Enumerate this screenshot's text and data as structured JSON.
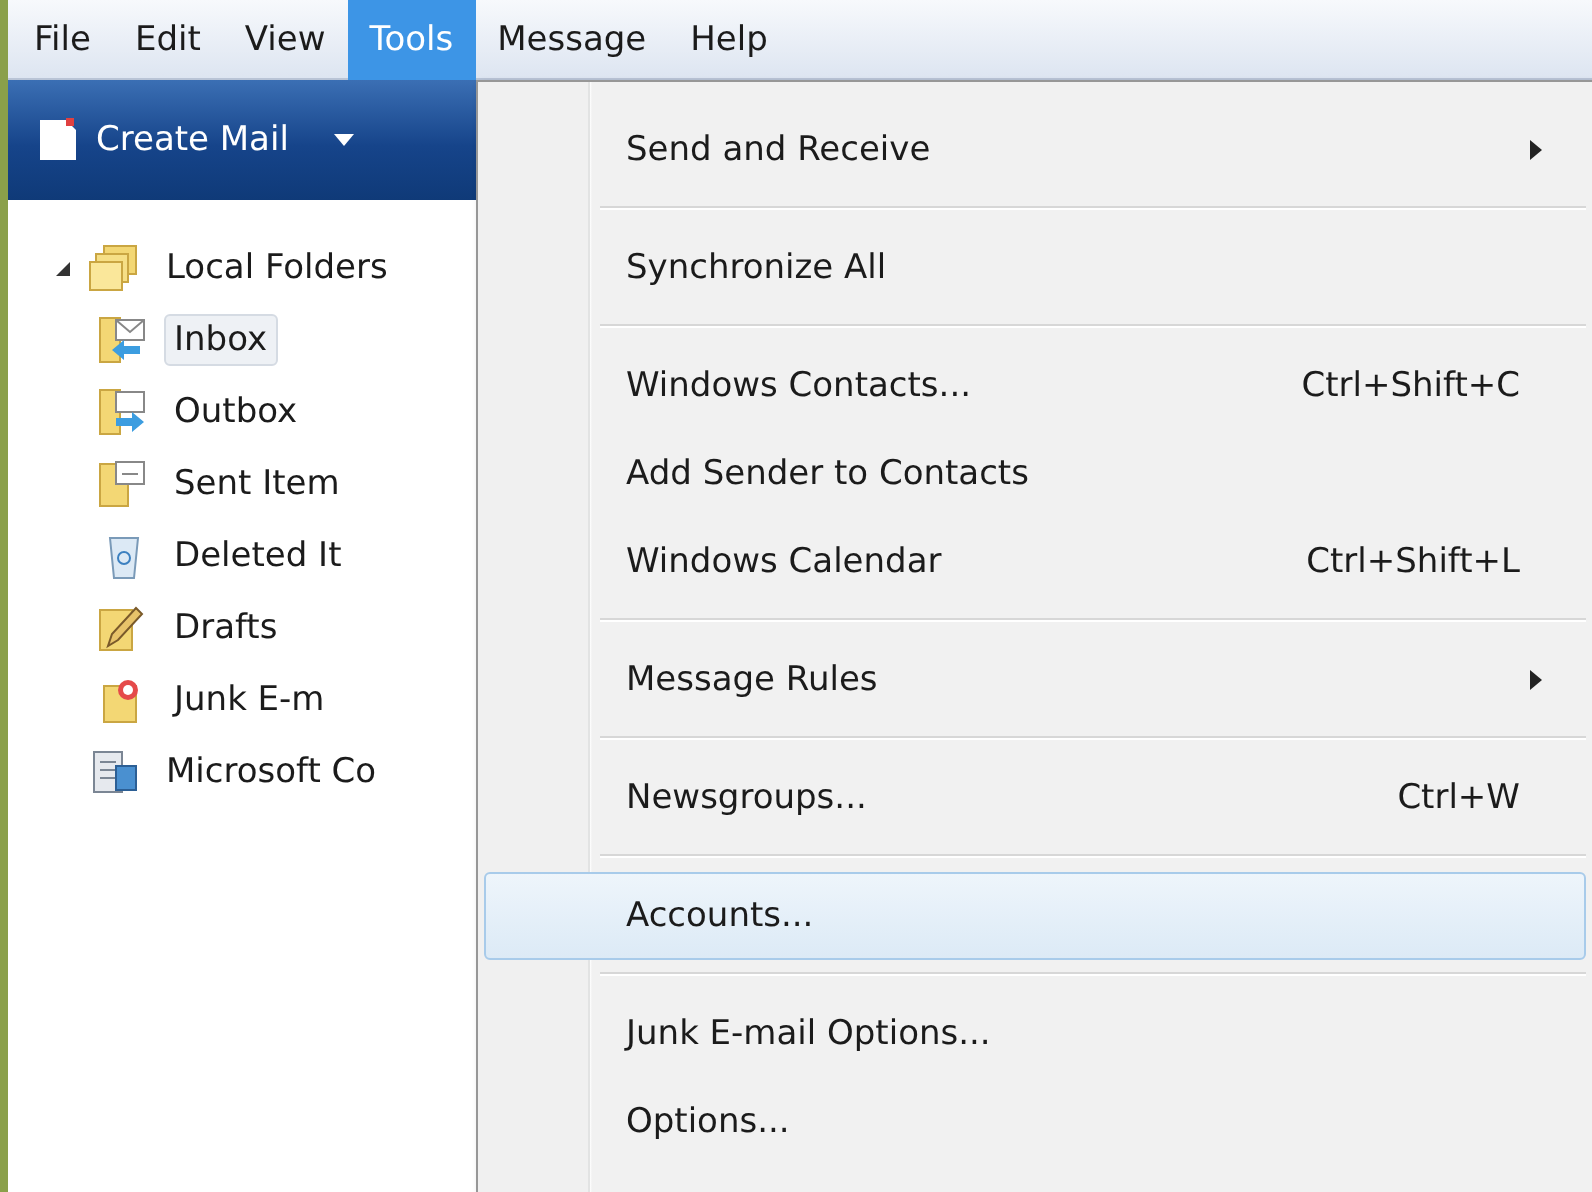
{
  "menubar": [
    {
      "label": "File",
      "selected": false
    },
    {
      "label": "Edit",
      "selected": false
    },
    {
      "label": "View",
      "selected": false
    },
    {
      "label": "Tools",
      "selected": true
    },
    {
      "label": "Message",
      "selected": false
    },
    {
      "label": "Help",
      "selected": false
    }
  ],
  "toolbar": {
    "create_mail": "Create Mail"
  },
  "folders": [
    {
      "label": "Local Folders",
      "expanded": true,
      "selected": false,
      "children": [
        {
          "label": "Inbox",
          "selected": true
        },
        {
          "label": "Outbox",
          "selected": false
        },
        {
          "label": "Sent Item",
          "selected": false
        },
        {
          "label": "Deleted It",
          "selected": false
        },
        {
          "label": "Drafts",
          "selected": false
        },
        {
          "label": "Junk E-m",
          "selected": false
        }
      ]
    },
    {
      "label": "Microsoft Co",
      "selected": false
    }
  ],
  "tools_menu": [
    {
      "kind": "item",
      "label": "Send and Receive",
      "submenu": true,
      "selected": false
    },
    {
      "kind": "separator"
    },
    {
      "kind": "item",
      "label": "Synchronize All",
      "selected": false
    },
    {
      "kind": "separator"
    },
    {
      "kind": "item",
      "label": "Windows Contacts...",
      "shortcut": "Ctrl+Shift+C",
      "selected": false
    },
    {
      "kind": "item",
      "label": "Add Sender to Contacts",
      "selected": false
    },
    {
      "kind": "item",
      "label": "Windows Calendar",
      "shortcut": "Ctrl+Shift+L",
      "selected": false
    },
    {
      "kind": "separator"
    },
    {
      "kind": "item",
      "label": "Message Rules",
      "submenu": true,
      "selected": false
    },
    {
      "kind": "separator"
    },
    {
      "kind": "item",
      "label": "Newsgroups...",
      "shortcut": "Ctrl+W",
      "selected": false
    },
    {
      "kind": "separator"
    },
    {
      "kind": "item",
      "label": "Accounts...",
      "selected": true
    },
    {
      "kind": "separator"
    },
    {
      "kind": "item",
      "label": "Junk E-mail Options...",
      "selected": false
    },
    {
      "kind": "item",
      "label": "Options...",
      "selected": false
    }
  ]
}
